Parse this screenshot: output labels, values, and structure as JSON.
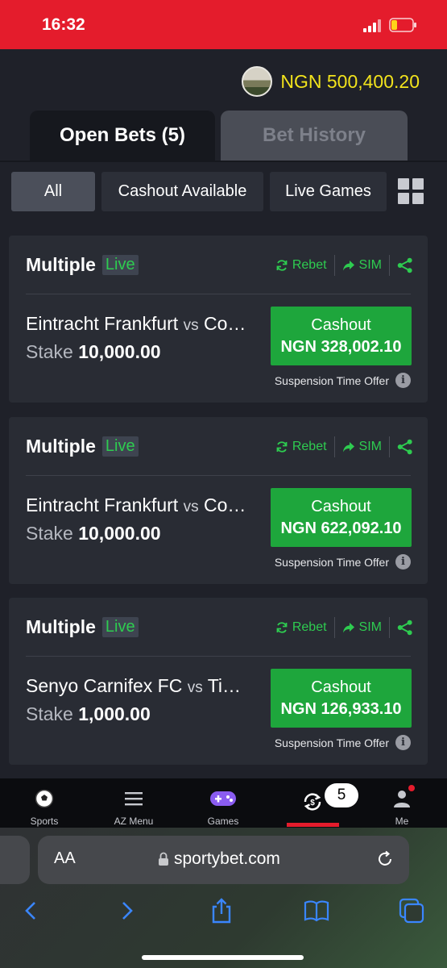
{
  "status_bar": {
    "time": "16:32"
  },
  "header": {
    "balance": "NGN 500,400.20"
  },
  "tabs": [
    {
      "label": "Open Bets (5)"
    },
    {
      "label": "Bet History"
    }
  ],
  "filters": [
    {
      "label": "All"
    },
    {
      "label": "Cashout Available"
    },
    {
      "label": "Live Games"
    }
  ],
  "card_common": {
    "live_label": "Live",
    "rebet_label": "Rebet",
    "sim_label": "SIM",
    "stake_label": "Stake",
    "vs_label": "vs",
    "cashout_label": "Cashout",
    "suspension_label": "Suspension Time Offer"
  },
  "bets": [
    {
      "type": "Multiple",
      "home": "Eintracht Frankfurt",
      "away": "Co…",
      "stake": "10,000.00",
      "cashout_amount": "NGN 328,002.10"
    },
    {
      "type": "Multiple",
      "home": "Eintracht Frankfurt",
      "away": "Co…",
      "stake": "10,000.00",
      "cashout_amount": "NGN 622,092.10"
    },
    {
      "type": "Multiple",
      "home": "Senyo Carnifex FC",
      "away": "Ti…",
      "stake": "1,000.00",
      "cashout_amount": "NGN 126,933.10"
    }
  ],
  "bottom_nav": {
    "items": [
      {
        "label": "Sports",
        "icon": "soccer-ball-icon"
      },
      {
        "label": "AZ Menu",
        "icon": "hamburger-menu-icon"
      },
      {
        "label": "Games",
        "icon": "gamepad-icon"
      },
      {
        "label": "",
        "icon": "open-bets-icon"
      },
      {
        "label": "Me",
        "icon": "user-icon"
      }
    ],
    "open_bets_badge": "5"
  },
  "browser": {
    "text_size_label": "AA",
    "url": "sportybet.com"
  },
  "colors": {
    "brand_red": "#e41c2c",
    "cashout_green": "#1ea63c",
    "live_green": "#2ecc50",
    "balance_yellow": "#f2e31c"
  }
}
